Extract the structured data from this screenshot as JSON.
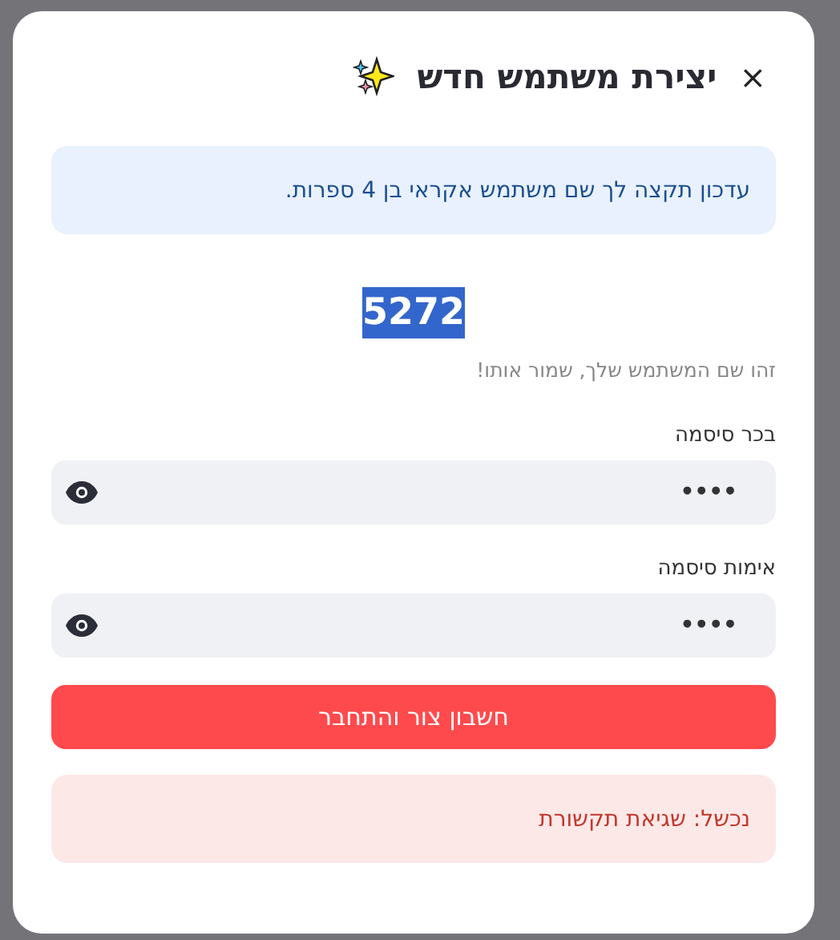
{
  "dialog": {
    "title": "יצירת משתמש חדש",
    "close_label": "×",
    "info": "עדכון תקצה לך שם משתמש אקראי בן 4 ספרות.",
    "username": {
      "text": "5272",
      "selected": true
    },
    "hint": "זהו שם המשתמש שלך, שמור אותו!",
    "fields": [
      {
        "label": "בכר סיסמה",
        "value": "••••"
      },
      {
        "label": "אימות סיסמה",
        "value": "••••"
      }
    ],
    "submit": "חשבון צור והתחבר",
    "error": "נכשל: שגיאת תקשורת"
  }
}
